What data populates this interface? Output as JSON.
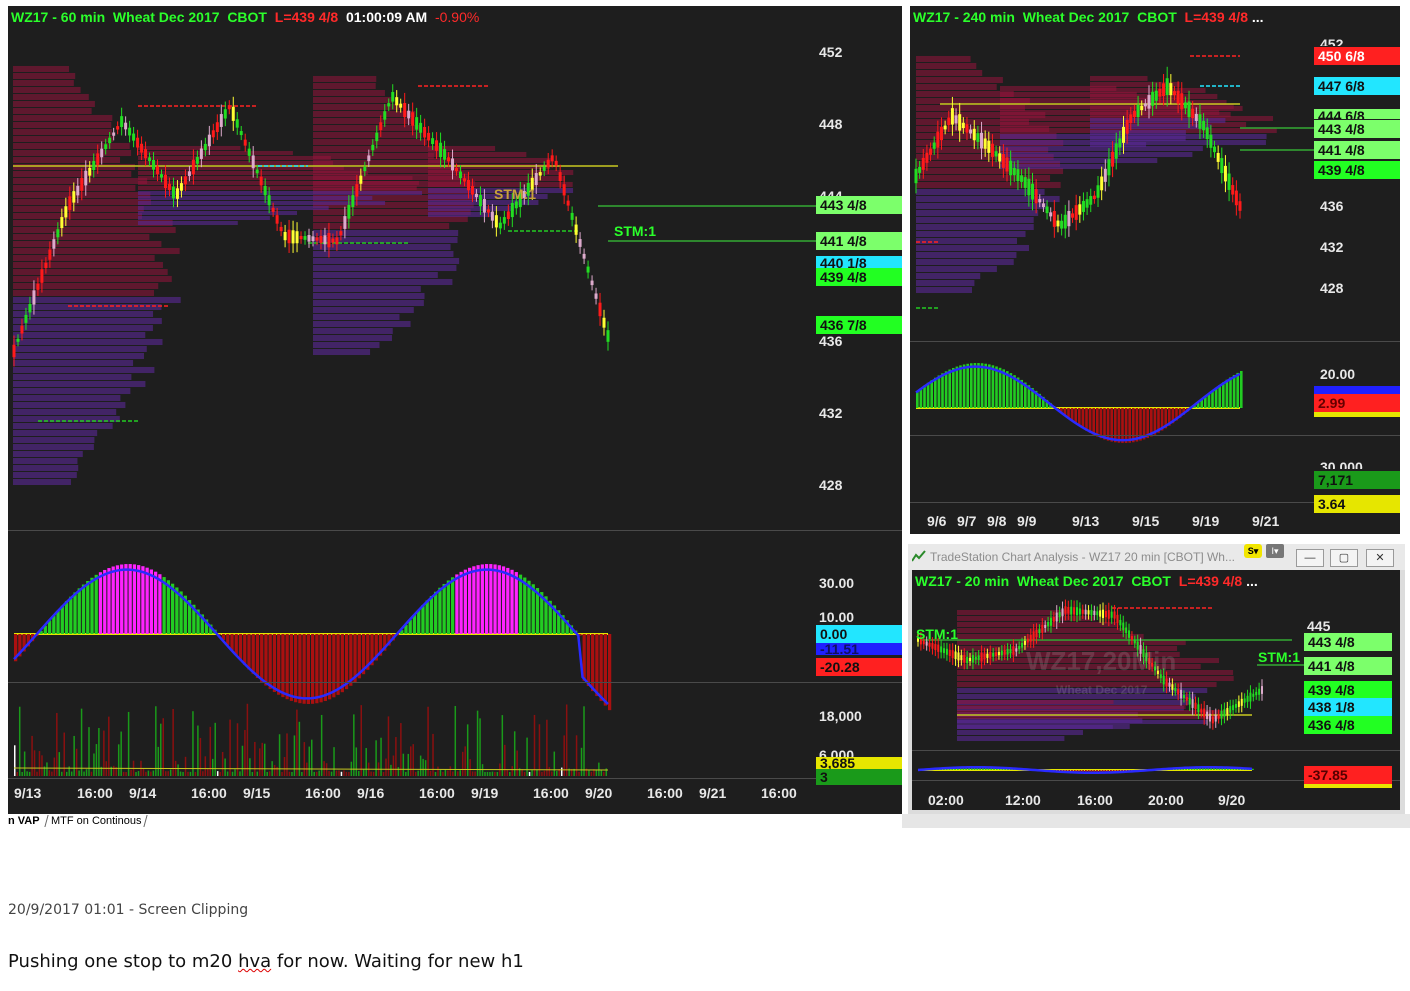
{
  "main_chart": {
    "title": {
      "symbol": "WZ17 - 60 min",
      "instrument": "Wheat Dec 2017",
      "exchange": "CBOT",
      "last": "L=439 4/8",
      "time": "01:00:09 AM",
      "change": "-0.90%"
    },
    "price_ticks": [
      "452",
      "448",
      "444",
      "436",
      "432",
      "428"
    ],
    "price_labels": [
      {
        "text": "443 4/8",
        "bg": "#7cff6b"
      },
      {
        "text": "441 4/8",
        "bg": "#7cff6b"
      },
      {
        "text": "440 1/8",
        "bg": "#22e6ff"
      },
      {
        "text": "439 4/8",
        "bg": "#22ff22"
      },
      {
        "text": "436 7/8",
        "bg": "#22ff22"
      }
    ],
    "stm_labels": [
      "STM:1",
      "STM:1"
    ],
    "osc_ticks": [
      "30.00",
      "10.00"
    ],
    "osc_labels": [
      {
        "text": "0.00",
        "bg": "#22e6ff"
      },
      {
        "text": "-11.51",
        "bg": "#2020ff"
      },
      {
        "text": "-20.28",
        "bg": "#ff2020"
      }
    ],
    "vol_ticks": [
      "18,000",
      "6,000"
    ],
    "vol_labels": [
      {
        "text": "3,685",
        "bg": "#e6e600"
      },
      {
        "text": "3",
        "bg": "#1a9a1a"
      }
    ],
    "time_labels": [
      "9/13",
      "16:00",
      "9/14",
      "16:00",
      "9/15",
      "16:00",
      "9/16",
      "16:00",
      "9/19",
      "16:00",
      "9/20",
      "16:00",
      "9/21",
      "16:00"
    ]
  },
  "h4_chart": {
    "title": {
      "symbol": "WZ17 - 240 min",
      "instrument": "Wheat Dec 2017",
      "exchange": "CBOT",
      "last": "L=439 4/8",
      "more": "..."
    },
    "price_ticks": [
      "452",
      "436",
      "432",
      "428"
    ],
    "price_labels": [
      {
        "text": "450 6/8",
        "bg": "#ff2020"
      },
      {
        "text": "447 6/8",
        "bg": "#22e6ff"
      },
      {
        "text": "444 6/8",
        "bg": "#7cff6b"
      },
      {
        "text": "443 4/8",
        "bg": "#7cff6b"
      },
      {
        "text": "441 4/8",
        "bg": "#7cff6b"
      },
      {
        "text": "439 4/8",
        "bg": "#22ff22"
      }
    ],
    "osc_ticks": [
      "20.00"
    ],
    "osc_labels": [
      {
        "text": "2.99",
        "bg": "#ff2020"
      }
    ],
    "vol_ticks": [
      "30,000"
    ],
    "vol_labels": [
      {
        "text": "7,171",
        "bg": "#1a9a1a"
      },
      {
        "text": "3.64",
        "bg": "#e6e600"
      }
    ],
    "time_labels": [
      "9/6",
      "9/7",
      "9/8",
      "9/9",
      "9/13",
      "9/15",
      "9/19",
      "9/21"
    ]
  },
  "m20_window": {
    "window_title": "TradeStation Chart Analysis - WZ17 20 min [CBOT] Wh...",
    "title": {
      "symbol": "WZ17 - 20 min",
      "instrument": "Wheat Dec 2017",
      "exchange": "CBOT",
      "last": "L=439 4/8",
      "more": "..."
    },
    "watermark": "WZ17,20Min",
    "watermark_sub": "Wheat Dec 2017",
    "price_ticks": [
      "445"
    ],
    "price_labels": [
      {
        "text": "443 4/8",
        "bg": "#7cff6b"
      },
      {
        "text": "441 4/8",
        "bg": "#7cff6b"
      },
      {
        "text": "439 4/8",
        "bg": "#22ff22"
      },
      {
        "text": "438 1/8",
        "bg": "#22e6ff"
      },
      {
        "text": "436 4/8",
        "bg": "#22ff22"
      }
    ],
    "stm_labels": [
      "STM:1",
      "STM:1"
    ],
    "osc_labels": [
      {
        "text": "-37.85",
        "bg": "#ff2020"
      }
    ],
    "time_labels": [
      "02:00",
      "12:00",
      "16:00",
      "20:00",
      "9/20"
    ]
  },
  "tabs": {
    "tab1": "n VAP",
    "tab2": "MTF on Continous"
  },
  "note": {
    "timestamp": "20/9/2017 01:01 - Screen Clipping",
    "text_before": "Pushing one stop to m20 ",
    "misspelled": "hva",
    "text_after": " for now. Waiting for new h1"
  }
}
